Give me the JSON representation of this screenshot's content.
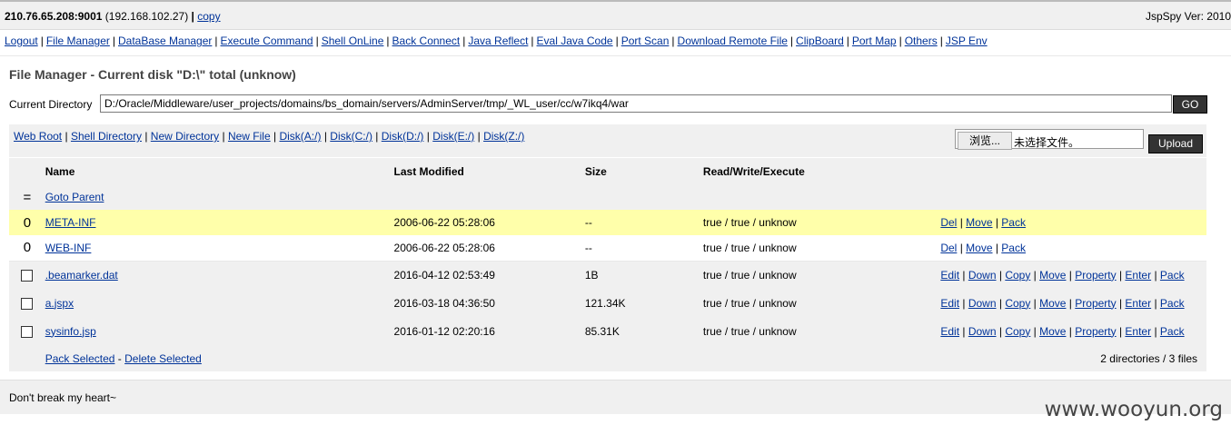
{
  "header": {
    "host": "210.76.65.208:9001",
    "ip": "(192.168.102.27)",
    "copy_label": "copy",
    "version": "JspSpy Ver: 2010"
  },
  "nav": [
    "Logout",
    "File Manager",
    "DataBase Manager",
    "Execute Command",
    "Shell OnLine",
    "Back Connect",
    "Java Reflect",
    "Eval Java Code",
    "Port Scan",
    "Download Remote File",
    "ClipBoard",
    "Port Map",
    "Others",
    "JSP Env"
  ],
  "page_title": "File Manager - Current disk \"D:\\\" total (unknow)",
  "current_directory": {
    "label": "Current Directory",
    "value": "D:/Oracle/Middleware/user_projects/domains/bs_domain/servers/AdminServer/tmp/_WL_user/cc/w7ikq4/war",
    "go_label": "GO"
  },
  "toolbar_links": [
    "Web Root",
    "Shell Directory",
    "New Directory",
    "New File",
    "Disk(A:/)",
    "Disk(C:/)",
    "Disk(D:/)",
    "Disk(E:/)",
    "Disk(Z:/)"
  ],
  "upload": {
    "browse_label": "浏览...",
    "no_file_label": "未选择文件。",
    "upload_label": "Upload"
  },
  "table": {
    "headers": [
      "Name",
      "Last Modified",
      "Size",
      "Read/Write/Execute"
    ],
    "parent_mark": "=",
    "parent_label": "Goto Parent",
    "dirs": [
      {
        "mark": "0",
        "name": "META-INF",
        "modified": "2006-06-22 05:28:06",
        "size": "--",
        "rwx": "true / true / unknow",
        "actions": [
          "Del",
          "Move",
          "Pack"
        ]
      },
      {
        "mark": "0",
        "name": "WEB-INF",
        "modified": "2006-06-22 05:28:06",
        "size": "--",
        "rwx": "true / true / unknow",
        "actions": [
          "Del",
          "Move",
          "Pack"
        ]
      }
    ],
    "files": [
      {
        "name": ".beamarker.dat",
        "modified": "2016-04-12 02:53:49",
        "size": "1B",
        "rwx": "true / true / unknow",
        "actions": [
          "Edit",
          "Down",
          "Copy",
          "Move",
          "Property",
          "Enter",
          "Pack"
        ]
      },
      {
        "name": "a.jspx",
        "modified": "2016-03-18 04:36:50",
        "size": "121.34K",
        "rwx": "true / true / unknow",
        "actions": [
          "Edit",
          "Down",
          "Copy",
          "Move",
          "Property",
          "Enter",
          "Pack"
        ]
      },
      {
        "name": "sysinfo.jsp",
        "modified": "2016-01-12 02:20:16",
        "size": "85.31K",
        "rwx": "true / true / unknow",
        "actions": [
          "Edit",
          "Down",
          "Copy",
          "Move",
          "Property",
          "Enter",
          "Pack"
        ]
      }
    ],
    "pack_selected": "Pack Selected",
    "dash": "-",
    "delete_selected": "Delete Selected",
    "summary": "2 directories / 3 files"
  },
  "footer": "Don't break my heart~",
  "watermark": "www.wooyun.org"
}
